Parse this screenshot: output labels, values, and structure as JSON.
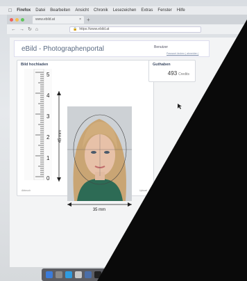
{
  "menubar": {
    "items": [
      "Firefox",
      "Datei",
      "Bearbeiten",
      "Ansicht",
      "Chronik",
      "Lesezeichen",
      "Extras",
      "Fenster",
      "Hilfe"
    ]
  },
  "browser": {
    "tab_title": "www.ebild.at",
    "url": "https://www.ebild.at"
  },
  "header": {
    "title": "eBild - Photographenportal",
    "user_label": "Benutzer",
    "user_links": "Passwort ändern | abmelden |"
  },
  "upload_panel": {
    "title": "Bild hochladen",
    "ruler_labels": [
      "5",
      "4",
      "3",
      "2",
      "1",
      "0"
    ],
    "height_label": "45 mm",
    "width_label": "35 mm",
    "left_action": "Abbruch",
    "right_action": "Upload"
  },
  "credit_panel": {
    "title": "Guthaben",
    "amount": "493",
    "unit": "Credits"
  },
  "colors": {
    "title_blue": "#5a6a82",
    "link_blue": "#7a8aa6",
    "traffic_red": "#f0605a",
    "traffic_yellow": "#f6be4f",
    "traffic_green": "#5fc55a"
  }
}
